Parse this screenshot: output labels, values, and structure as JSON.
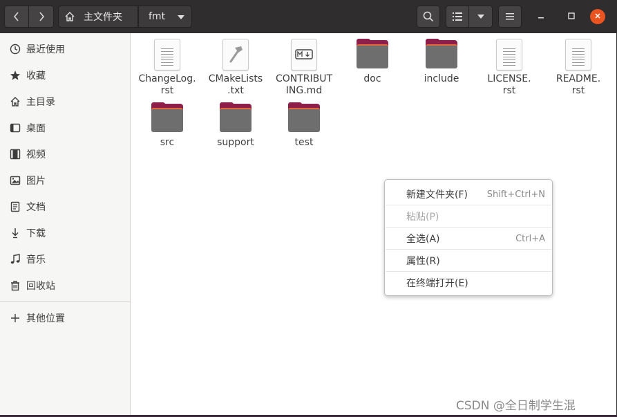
{
  "header": {
    "path": [
      "主文件夹",
      "fmt"
    ]
  },
  "sidebar": {
    "items": [
      {
        "label": "最近使用",
        "icon": "clock-icon"
      },
      {
        "label": "收藏",
        "icon": "star-icon"
      },
      {
        "label": "主目录",
        "icon": "home-icon"
      },
      {
        "label": "桌面",
        "icon": "desktop-icon"
      },
      {
        "label": "视频",
        "icon": "video-icon"
      },
      {
        "label": "图片",
        "icon": "image-icon"
      },
      {
        "label": "文档",
        "icon": "document-icon"
      },
      {
        "label": "下载",
        "icon": "download-icon"
      },
      {
        "label": "音乐",
        "icon": "music-icon"
      },
      {
        "label": "回收站",
        "icon": "trash-icon"
      }
    ],
    "other_locations": {
      "label": "其他位置",
      "icon": "plus-icon"
    }
  },
  "files": [
    {
      "name": "ChangeLog.\nrst",
      "type": "text-file"
    },
    {
      "name": "CMakeLists\n.txt",
      "type": "cmake-file"
    },
    {
      "name": "CONTRIBUT\nING.md",
      "type": "markdown-file"
    },
    {
      "name": "doc",
      "type": "folder"
    },
    {
      "name": "include",
      "type": "folder"
    },
    {
      "name": "LICENSE.\nrst",
      "type": "text-file"
    },
    {
      "name": "README.\nrst",
      "type": "text-file"
    },
    {
      "name": "src",
      "type": "folder"
    },
    {
      "name": "support",
      "type": "folder"
    },
    {
      "name": "test",
      "type": "folder"
    }
  ],
  "context_menu": {
    "items": [
      {
        "label": "新建文件夹(F)",
        "accel": "Shift+Ctrl+N",
        "enabled": true
      },
      {
        "label": "粘贴(P)",
        "accel": "",
        "enabled": false
      },
      {
        "label": "全选(A)",
        "accel": "Ctrl+A",
        "enabled": true
      },
      {
        "label": "属性(R)",
        "accel": "",
        "enabled": true
      },
      {
        "label": "在终端打开(E)",
        "accel": "",
        "enabled": true
      }
    ]
  },
  "watermark": "CSDN @全日制学生混",
  "colors": {
    "accent": "#e95420",
    "folder": "#8e1f4b",
    "header": "#2f2d2d"
  }
}
